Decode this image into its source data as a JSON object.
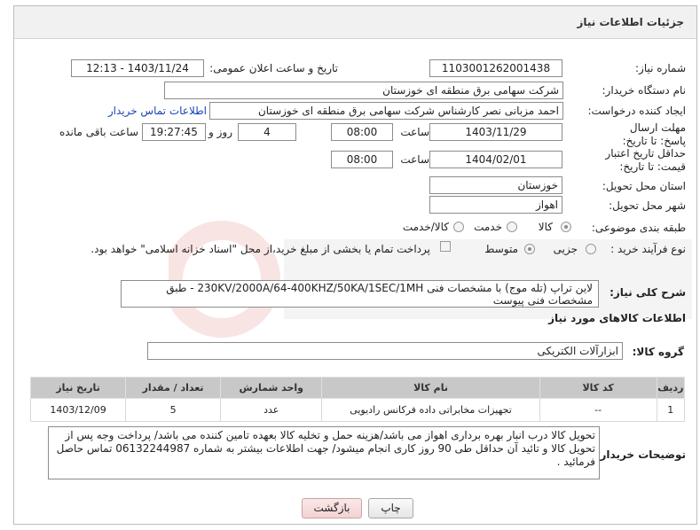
{
  "header": {
    "title": "جزئیات اطلاعات نیاز"
  },
  "form": {
    "need_number_label": "شماره نیاز:",
    "need_number": "1103001262001438",
    "announce_label": "تاریخ و ساعت اعلان عمومی:",
    "announce_value": "1403/11/24 - 12:13",
    "buyer_org_label": "نام دستگاه خریدار:",
    "buyer_org": "شرکت سهامی برق منطقه ای خوزستان",
    "creator_label": "ایجاد کننده درخواست:",
    "creator": "احمد مزبانی نصر کارشناس شرکت سهامی برق منطقه ای خوزستان",
    "contact_link": "اطلاعات تماس خریدار",
    "reply_deadline_label": "مهلت ارسال پاسخ: تا تاریخ:",
    "reply_date": "1403/11/29",
    "time_label": "ساعت",
    "reply_time": "08:00",
    "days_value": "4",
    "days_label": "روز و",
    "remaining_time": "19:27:45",
    "remaining_label": "ساعت باقی مانده",
    "price_validity_label": "حداقل تاریخ اعتبار قیمت: تا تاریخ:",
    "price_date": "1404/02/01",
    "price_time": "08:00",
    "province_label": "استان محل تحویل:",
    "province": "خوزستان",
    "city_label": "شهر محل تحویل:",
    "city": "اهواز",
    "category_label": "طبقه بندی موضوعی:",
    "category_options": [
      "کالا",
      "خدمت",
      "کالا/خدمت"
    ],
    "process_label": "نوع فرآیند خرید :",
    "process_options": [
      "جزیی",
      "متوسط"
    ],
    "payment_note": "پرداخت تمام یا بخشی از مبلغ خرید،از محل \"اسناد خزانه اسلامی\" خواهد بود."
  },
  "description": {
    "label": "شرح کلی نیاز:",
    "text": "لاین تراپ (تله موج) با مشخصات فنی 230KV/2000A/64-400KHZ/50KA/1SEC/1MH - طبق مشخصات فنی پیوست"
  },
  "goods_info_title": "اطلاعات کالاهای مورد نیاز",
  "goods_group_label": "گروه کالا:",
  "goods_group": "ابزارآلات الکتریکی",
  "table": {
    "headers": [
      "ردیف",
      "کد کالا",
      "نام کالا",
      "واحد شمارش",
      "تعداد / مقدار",
      "تاریخ نیاز"
    ],
    "rows": [
      [
        "1",
        "--",
        "تجهیزات مخابراتی داده فرکانس رادیویی",
        "عدد",
        "5",
        "1403/12/09"
      ]
    ]
  },
  "buyer_notes": {
    "label": "توضیحات خریدار:",
    "text": "تحویل کالا درب انبار بهره برداری اهواز می باشد/هزینه حمل و تخلیه کالا بعهده تامین کننده می باشد/ پرداخت وجه پس از تحویل کالا و تائید آن حداقل طی 90 روز کاری انجام میشود/  جهت اطلاعات بیشتر به شماره  06132244987 تماس حاصل فرمائید ."
  },
  "buttons": {
    "print": "چاپ",
    "back": "بازگشت"
  },
  "colors": {
    "link": "#1a44b8",
    "header_bg": "#f1f1f1",
    "table_header_bg": "#c8c8c8",
    "back_button_bg": "#f3d2d2"
  }
}
